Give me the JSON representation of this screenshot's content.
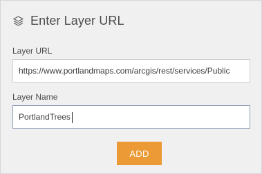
{
  "dialog": {
    "title": "Enter Layer URL",
    "header_icon": "layers-icon"
  },
  "fields": {
    "layer_url": {
      "label": "Layer URL",
      "value": "https://www.portlandmaps.com/arcgis/rest/services/Public"
    },
    "layer_name": {
      "label": "Layer Name",
      "value": "PortlandTrees"
    }
  },
  "actions": {
    "add_label": "ADD"
  },
  "colors": {
    "panel_background": "#f0f0f0",
    "accent_button": "#ec9a35",
    "active_border": "#8a9bb4"
  }
}
